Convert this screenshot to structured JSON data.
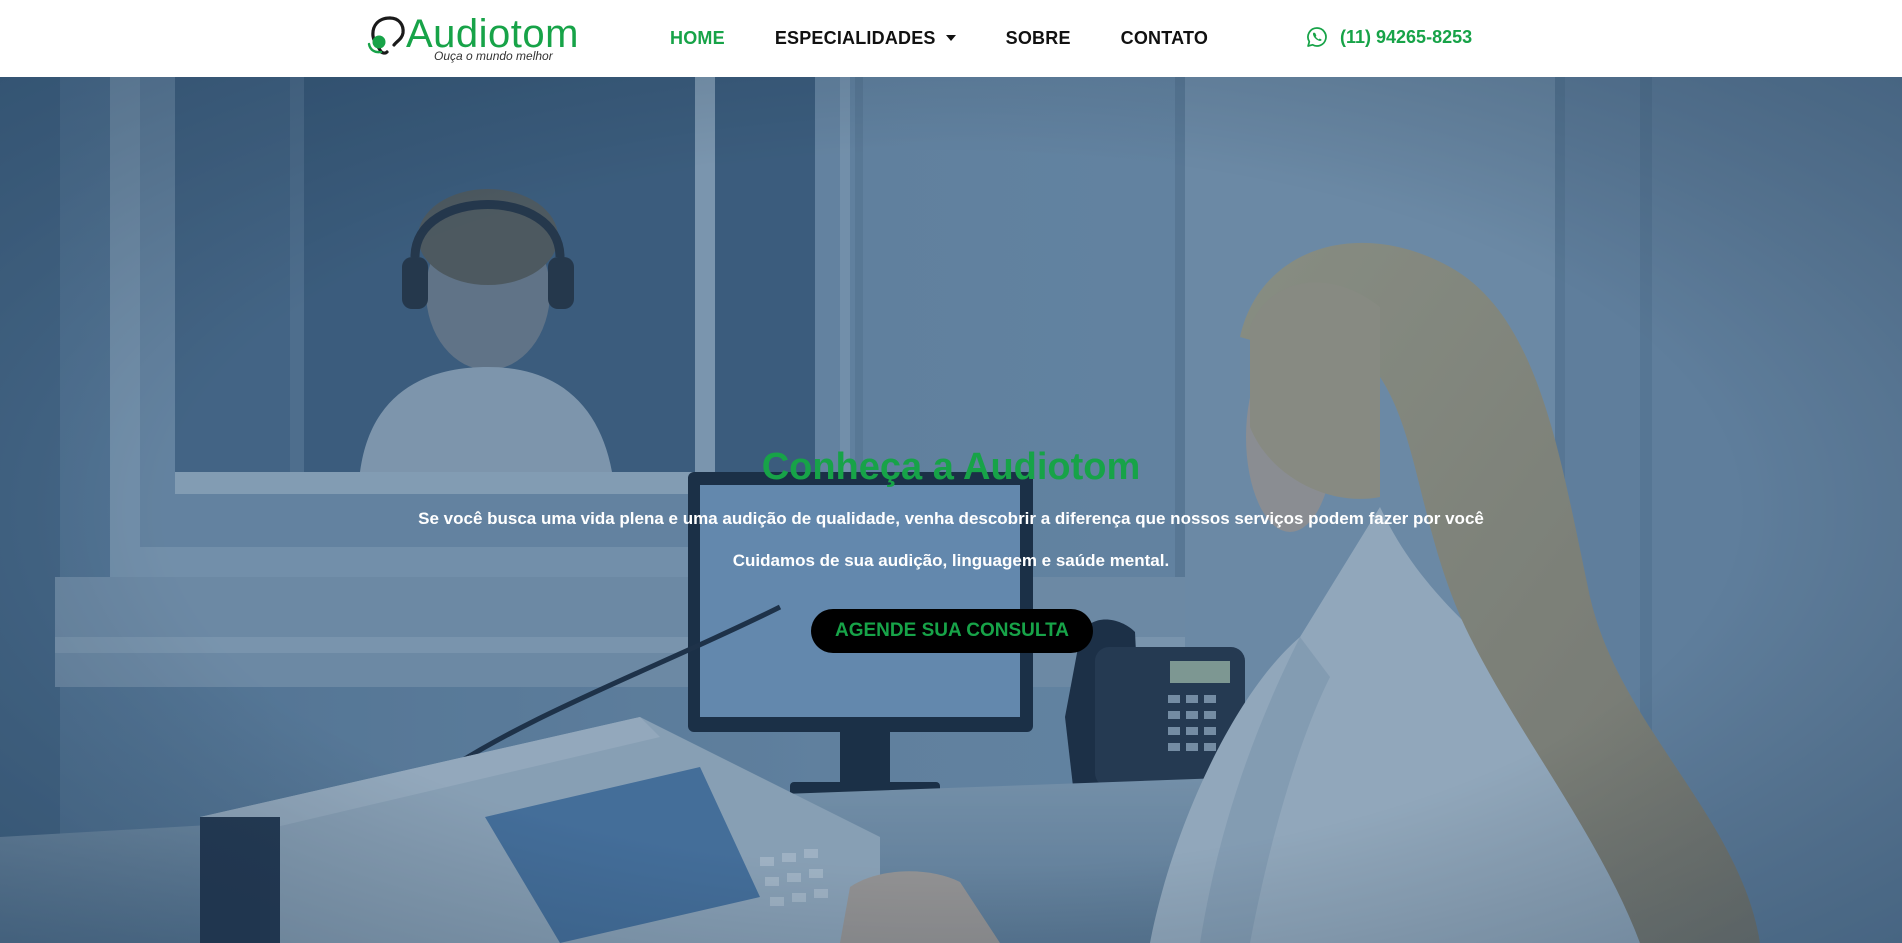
{
  "header": {
    "logo_name": "Audiotom",
    "logo_tagline": "Ouça o mundo melhor",
    "nav": [
      {
        "label": "HOME"
      },
      {
        "label": "ESPECIALIDADES"
      },
      {
        "label": "SOBRE"
      },
      {
        "label": "CONTATO"
      }
    ],
    "phone": "(11) 94265-8253"
  },
  "hero": {
    "title": "Conheça a Audiotom",
    "subtitle_line1": "Se você busca uma vida plena e uma audição de qualidade, venha descobrir a diferença que nossos serviços podem fazer por você",
    "subtitle_line2": "Cuidamos de sua audição, linguagem e saúde mental.",
    "cta_label": "AGENDE SUA CONSULTA"
  },
  "colors": {
    "brand_green": "#17a348",
    "text_dark": "#111111",
    "hero_overlay": "#1e466e",
    "cta_background": "#000000"
  },
  "icons": {
    "logo": "ear-logo-icon",
    "dropdown": "chevron-down-icon",
    "phone": "whatsapp-icon"
  }
}
